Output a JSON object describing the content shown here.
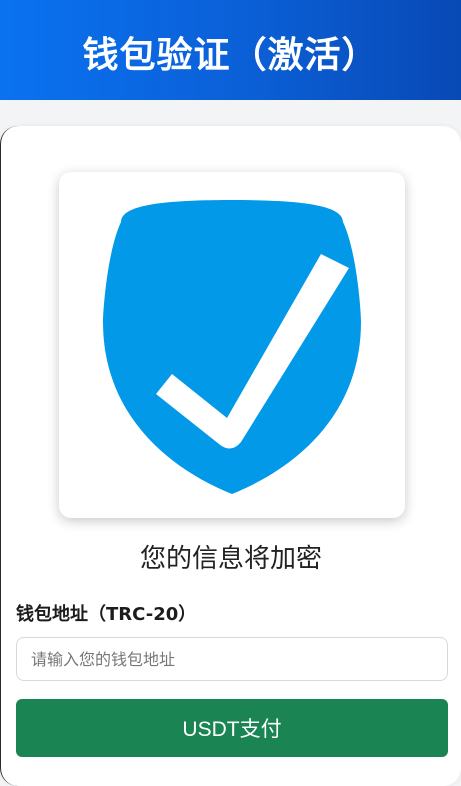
{
  "header": {
    "title": "钱包验证（激活）"
  },
  "main": {
    "security_message": "您的信息将加密",
    "wallet_label": "钱包地址（TRC-20）",
    "wallet_placeholder": "请输入您的钱包地址",
    "wallet_value": "",
    "pay_button_label": "USDT支付"
  },
  "icons": {
    "hero": "shield-check-icon"
  },
  "colors": {
    "header_start": "#0a72f0",
    "header_end": "#0849b5",
    "shield": "#0299e8",
    "pay_button": "#1a8453"
  }
}
